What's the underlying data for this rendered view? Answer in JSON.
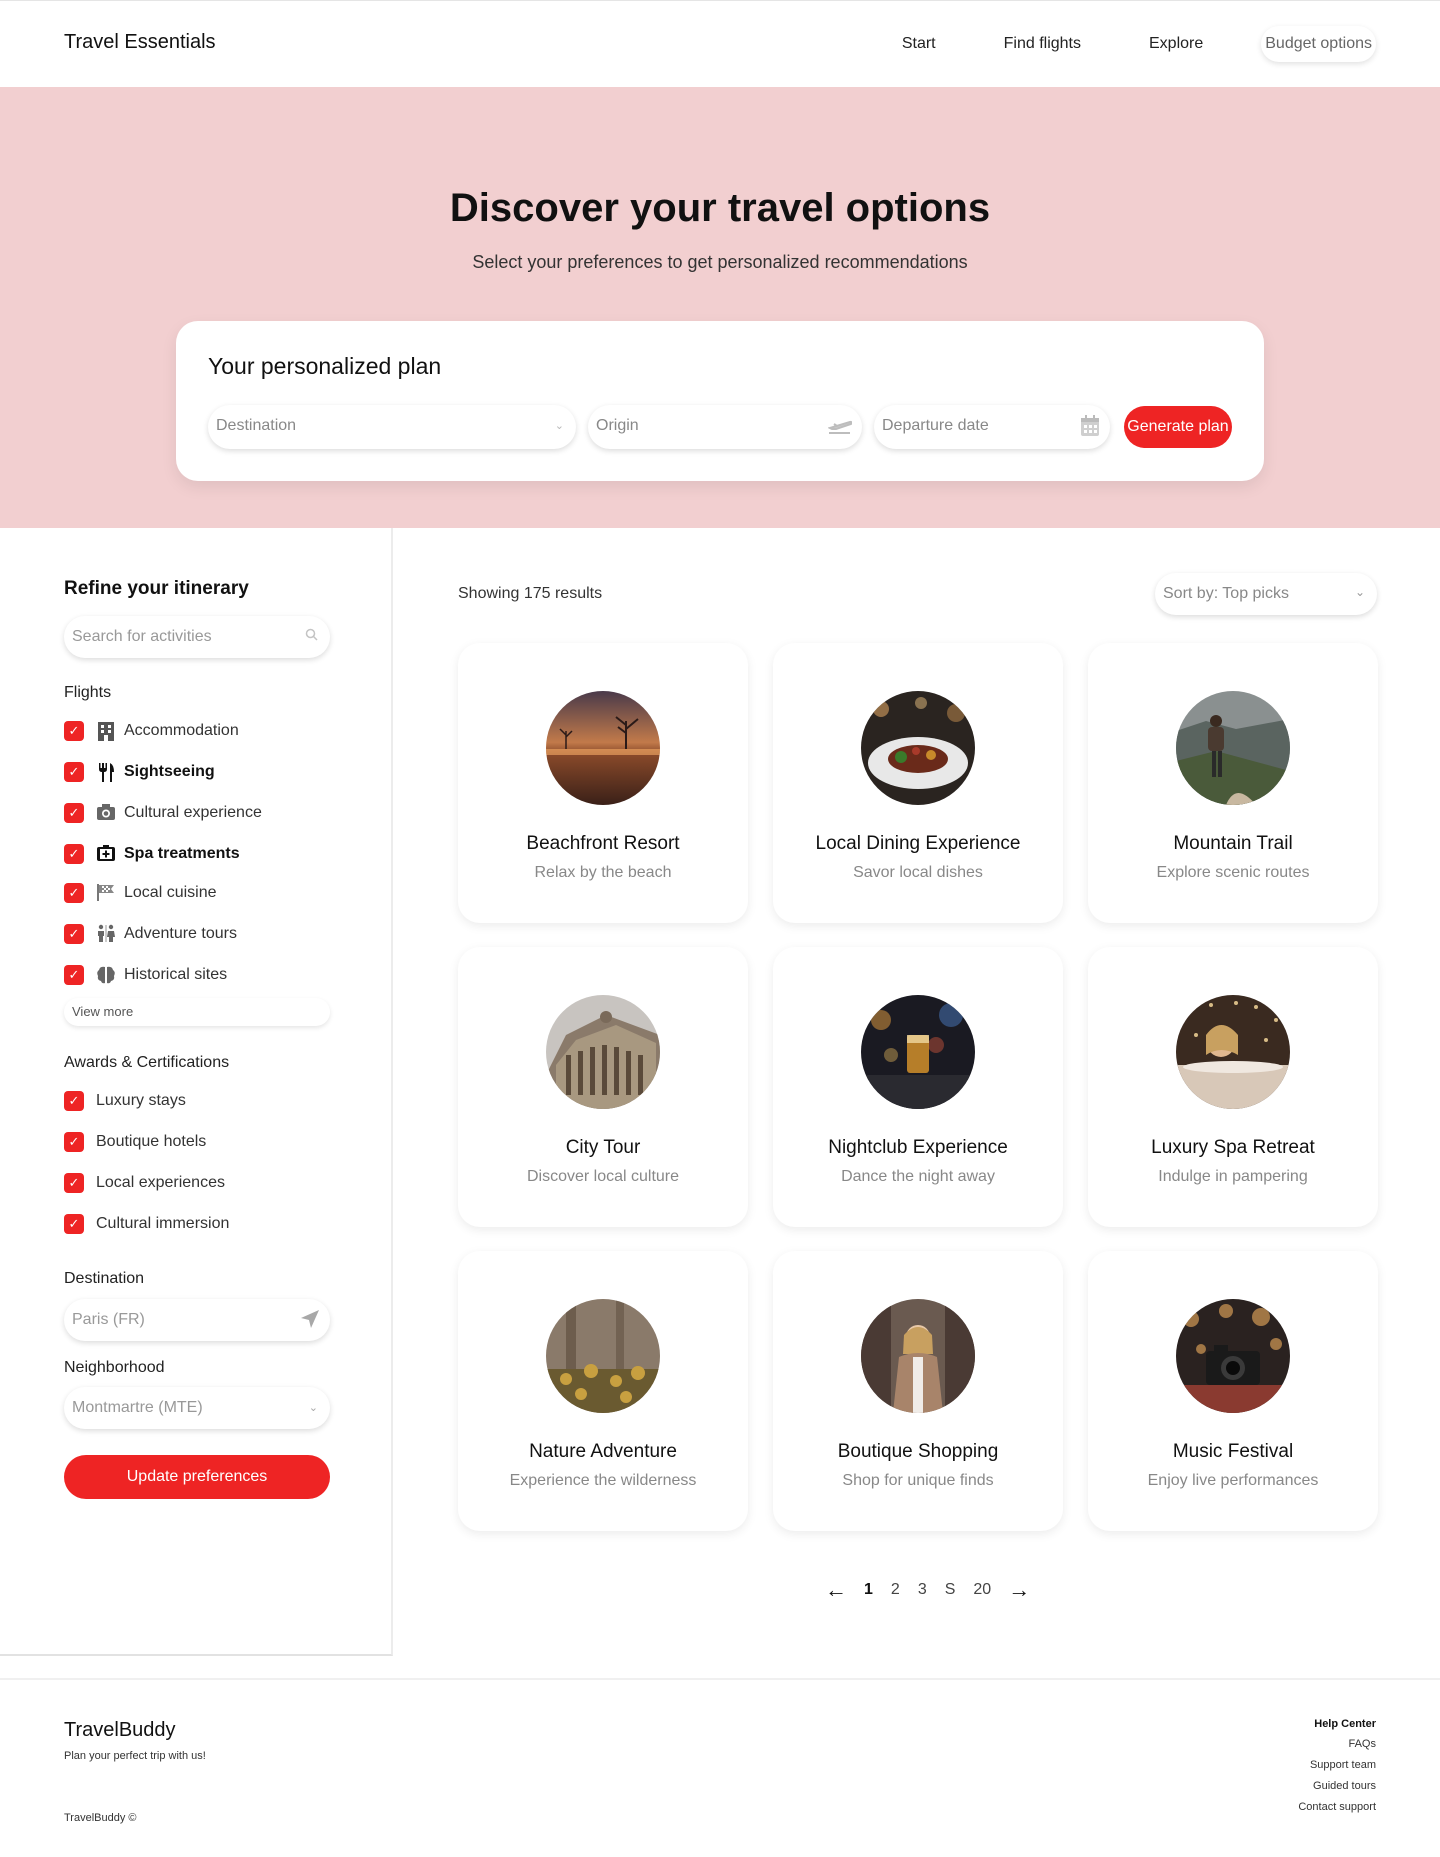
{
  "header": {
    "brand": "Travel Essentials",
    "nav": [
      "Start",
      "Find flights",
      "Explore",
      "Budget options"
    ]
  },
  "hero": {
    "title": "Discover your travel options",
    "subtitle": "Select your preferences to get personalized recommendations",
    "plan": {
      "title": "Your personalized plan",
      "destination_placeholder": "Destination",
      "origin_placeholder": "Origin",
      "date_placeholder": "Departure date",
      "button": "Generate plan"
    }
  },
  "sidebar": {
    "title": "Refine your itinerary",
    "search_placeholder": "Search for activities",
    "flights_label": "Flights",
    "flights": [
      {
        "label": "Accommodation",
        "checked": true,
        "icon": "building-icon"
      },
      {
        "label": "Sightseeing",
        "checked": true,
        "icon": "utensils-icon"
      },
      {
        "label": "Cultural experience",
        "checked": true,
        "icon": "camera-icon"
      },
      {
        "label": "Spa treatments",
        "checked": true,
        "icon": "first-aid-icon"
      },
      {
        "label": "Local cuisine",
        "checked": true,
        "icon": "flag-icon"
      },
      {
        "label": "Adventure tours",
        "checked": true,
        "icon": "people-icon"
      },
      {
        "label": "Historical sites",
        "checked": true,
        "icon": "brain-icon"
      }
    ],
    "view_more": "View more",
    "awards_label": "Awards & Certifications",
    "awards": [
      {
        "label": "Luxury stays",
        "checked": true
      },
      {
        "label": "Boutique hotels",
        "checked": true
      },
      {
        "label": "Local experiences",
        "checked": true
      },
      {
        "label": "Cultural immersion",
        "checked": true
      }
    ],
    "destination_label": "Destination",
    "destination_placeholder": "Paris (FR)",
    "neighborhood_label": "Neighborhood",
    "neighborhood_value": "Montmartre (MTE)",
    "update_button": "Update preferences"
  },
  "main": {
    "results": "Showing 175 results",
    "sort": "Sort by: Top picks",
    "cards": [
      {
        "title": "Beachfront Resort",
        "desc": "Relax by the beach"
      },
      {
        "title": "Local Dining Experience",
        "desc": "Savor local dishes"
      },
      {
        "title": "Mountain Trail",
        "desc": "Explore scenic routes"
      },
      {
        "title": "City Tour",
        "desc": "Discover local culture"
      },
      {
        "title": "Nightclub Experience",
        "desc": "Dance the night away"
      },
      {
        "title": "Luxury Spa Retreat",
        "desc": "Indulge in pampering"
      },
      {
        "title": "Nature Adventure",
        "desc": "Experience the wilderness"
      },
      {
        "title": "Boutique Shopping",
        "desc": "Shop for unique finds"
      },
      {
        "title": "Music Festival",
        "desc": "Enjoy live performances"
      }
    ],
    "pagination": [
      "1",
      "2",
      "3",
      "S",
      "20"
    ]
  },
  "footer": {
    "brand": "TravelBuddy",
    "tagline": "Plan your perfect trip with us!",
    "copyright": "TravelBuddy ©",
    "links_title": "Help Center",
    "links": [
      "FAQs",
      "Support team",
      "Guided tours",
      "Contact support"
    ]
  },
  "colors": {
    "accent": "#ee2424",
    "hero_bg": "#f2cfd0"
  }
}
